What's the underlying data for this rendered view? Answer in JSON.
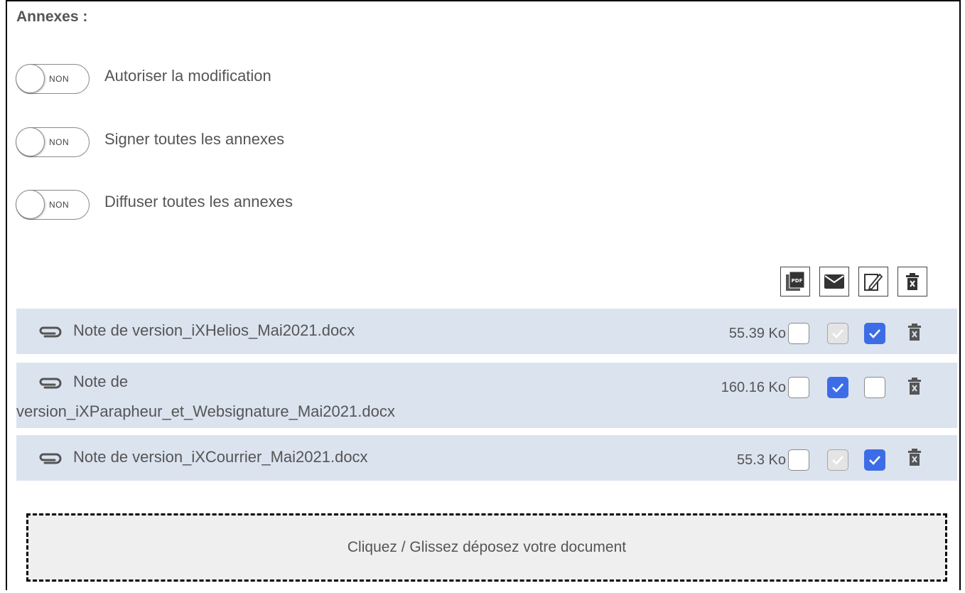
{
  "section": {
    "title": "Annexes :"
  },
  "toggles": [
    {
      "state": "NON",
      "label": "Autoriser la modification"
    },
    {
      "state": "NON",
      "label": "Signer toutes les annexes"
    },
    {
      "state": "NON",
      "label": "Diffuser toutes les annexes"
    }
  ],
  "actions": [
    {
      "icon": "pdf-icon",
      "badge": "PDF"
    },
    {
      "icon": "envelope-icon"
    },
    {
      "icon": "sign-icon"
    },
    {
      "icon": "trash-icon"
    }
  ],
  "files": [
    {
      "name": "Note de version_iXHelios_Mai2021.docx",
      "size": "55.39 Ko",
      "checks": [
        "unchecked",
        "grey-checked",
        "checked"
      ]
    },
    {
      "name_line1": "Note de",
      "name_line2": "version_iXParapheur_et_Websignature_Mai2021.docx",
      "size": "160.16 Ko",
      "checks": [
        "unchecked",
        "checked",
        "unchecked"
      ]
    },
    {
      "name": "Note de version_iXCourrier_Mai2021.docx",
      "size": "55.3 Ko",
      "checks": [
        "unchecked",
        "grey-checked",
        "checked"
      ]
    }
  ],
  "dropzone": {
    "label": "Cliquez / Glissez déposez votre document"
  },
  "colors": {
    "row_bg": "#dbe3ef",
    "checked": "#3d6de6",
    "text": "#555555"
  }
}
